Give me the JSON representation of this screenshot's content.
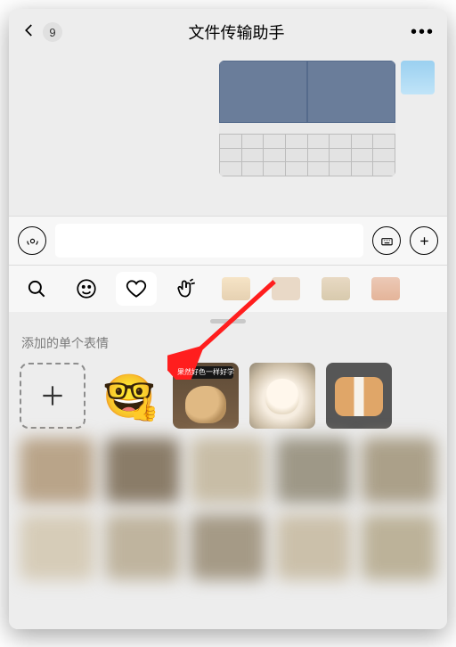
{
  "header": {
    "unread_count": "9",
    "title": "文件传输助手"
  },
  "panel": {
    "section_title": "添加的单个表情"
  },
  "stickers": {
    "emoji_face": "🤓",
    "doge_caption": "果然好色一样好学"
  }
}
